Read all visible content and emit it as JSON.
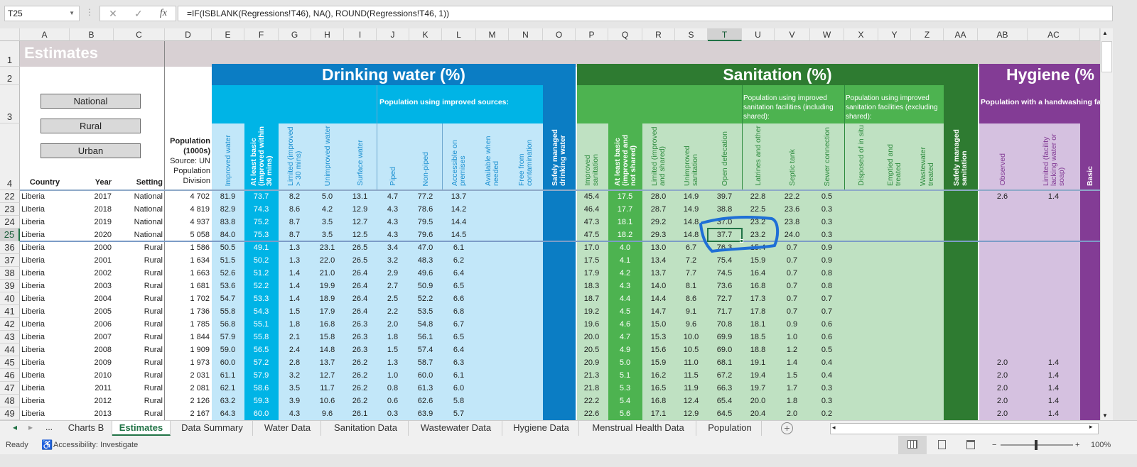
{
  "colors": {
    "light_blue": "#c2e7f9",
    "cyan": "#00b4e6",
    "dark_blue": "#0b7dc4",
    "light_green": "#bfe1c2",
    "mid_green": "#4db350",
    "dark_green": "#2e7b31",
    "light_purple": "#d5c1e0",
    "purple": "#833c95",
    "title_gray": "#d8d0d3",
    "selection": "#217346",
    "annotation": "#1f6fd6"
  },
  "formula_bar": {
    "name_box": "T25",
    "cancel_icon": "✕",
    "enter_icon": "✓",
    "fx_label": "fx",
    "formula": "=IF(ISBLANK(Regressions!T46), NA(), ROUND(Regressions!T46, 1))"
  },
  "columns": [
    "A",
    "B",
    "C",
    "D",
    "E",
    "F",
    "G",
    "H",
    "I",
    "J",
    "K",
    "L",
    "M",
    "N",
    "O",
    "P",
    "Q",
    "R",
    "S",
    "T",
    "U",
    "V",
    "W",
    "X",
    "Y",
    "Z",
    "AA",
    "AB",
    "AC"
  ],
  "header_rows": [
    "1",
    "2",
    "3",
    "4"
  ],
  "sheet_title": "Estimates",
  "setting_buttons": [
    "National",
    "Rural",
    "Urban"
  ],
  "titles": {
    "water": "Drinking water (%)",
    "sanitation": "Sanitation (%)",
    "hygiene": "Hygiene (%"
  },
  "groups": {
    "water_improved": "Population using improved sources:",
    "san_incl": "Population using improved sanitation facilities (including shared):",
    "san_excl": "Population using improved sanitation facilities (excluding shared):",
    "hygiene": "Population with a handwashing fa"
  },
  "column_headers": {
    "A": "Country",
    "B": "Year",
    "C": "Setting",
    "D_bold": "Population (1000s)",
    "D_source": "Source: UN Population Division",
    "E": "Improved water",
    "F": "At least basic (improved within 30 mins)",
    "G": "Limited (improved > 30 mins)",
    "H": "Unimproved water",
    "I": "Surface water",
    "J": "Piped",
    "K": "Non-piped",
    "L": "Accessible on premises",
    "M": "Available when needed",
    "N": "Free from contamination",
    "O": "Safely managed drinking water",
    "P": "Improved sanitation",
    "Q": "At least basic (improved and not shared)",
    "R": "Limited (improved and shared)",
    "S": "Unimproved sanitation",
    "T": "Open defecation",
    "U": "Latrines and other",
    "V": "Septic tank",
    "W": "Sewer connection",
    "X": "Disposed of in situ",
    "Y": "Emptied and treated",
    "Z": "Wastewater treated",
    "AA": "Safely managed sanitation",
    "AB": "Observed",
    "AC": "Limited (facility lacking water or soap)",
    "AD": "Basic"
  },
  "rows": [
    {
      "n": "22",
      "cells": [
        "Liberia",
        "2017",
        "National",
        "4 702",
        "81.9",
        "73.7",
        "8.2",
        "5.0",
        "13.1",
        "4.7",
        "77.2",
        "13.7",
        "",
        "",
        "",
        "45.4",
        "17.5",
        "28.0",
        "14.9",
        "39.7",
        "22.8",
        "22.2",
        "0.5",
        "",
        "",
        "",
        "",
        "2.6",
        "1.4"
      ]
    },
    {
      "n": "23",
      "cells": [
        "Liberia",
        "2018",
        "National",
        "4 819",
        "82.9",
        "74.3",
        "8.6",
        "4.2",
        "12.9",
        "4.3",
        "78.6",
        "14.2",
        "",
        "",
        "",
        "46.4",
        "17.7",
        "28.7",
        "14.9",
        "38.8",
        "22.5",
        "23.6",
        "0.3",
        "",
        "",
        "",
        "",
        "",
        ""
      ]
    },
    {
      "n": "24",
      "cells": [
        "Liberia",
        "2019",
        "National",
        "4 937",
        "83.8",
        "75.2",
        "8.7",
        "3.5",
        "12.7",
        "4.3",
        "79.5",
        "14.4",
        "",
        "",
        "",
        "47.3",
        "18.1",
        "29.2",
        "14.8",
        "37.0",
        "23.2",
        "23.8",
        "0.3",
        "",
        "",
        "",
        "",
        "",
        ""
      ]
    },
    {
      "n": "25",
      "cells": [
        "Liberia",
        "2020",
        "National",
        "5 058",
        "84.0",
        "75.3",
        "8.7",
        "3.5",
        "12.5",
        "4.3",
        "79.6",
        "14.5",
        "",
        "",
        "",
        "47.5",
        "18.2",
        "29.3",
        "14.8",
        "37.7",
        "23.2",
        "24.0",
        "0.3",
        "",
        "",
        "",
        "",
        "",
        ""
      ]
    },
    {
      "n": "36",
      "cells": [
        "Liberia",
        "2000",
        "Rural",
        "1 586",
        "50.5",
        "49.1",
        "1.3",
        "23.1",
        "26.5",
        "3.4",
        "47.0",
        "6.1",
        "",
        "",
        "",
        "17.0",
        "4.0",
        "13.0",
        "6.7",
        "76.3",
        "15.4",
        "0.7",
        "0.9",
        "",
        "",
        "",
        "",
        "",
        ""
      ]
    },
    {
      "n": "37",
      "cells": [
        "Liberia",
        "2001",
        "Rural",
        "1 634",
        "51.5",
        "50.2",
        "1.3",
        "22.0",
        "26.5",
        "3.2",
        "48.3",
        "6.2",
        "",
        "",
        "",
        "17.5",
        "4.1",
        "13.4",
        "7.2",
        "75.4",
        "15.9",
        "0.7",
        "0.9",
        "",
        "",
        "",
        "",
        "",
        ""
      ]
    },
    {
      "n": "38",
      "cells": [
        "Liberia",
        "2002",
        "Rural",
        "1 663",
        "52.6",
        "51.2",
        "1.4",
        "21.0",
        "26.4",
        "2.9",
        "49.6",
        "6.4",
        "",
        "",
        "",
        "17.9",
        "4.2",
        "13.7",
        "7.7",
        "74.5",
        "16.4",
        "0.7",
        "0.8",
        "",
        "",
        "",
        "",
        "",
        ""
      ]
    },
    {
      "n": "39",
      "cells": [
        "Liberia",
        "2003",
        "Rural",
        "1 681",
        "53.6",
        "52.2",
        "1.4",
        "19.9",
        "26.4",
        "2.7",
        "50.9",
        "6.5",
        "",
        "",
        "",
        "18.3",
        "4.3",
        "14.0",
        "8.1",
        "73.6",
        "16.8",
        "0.7",
        "0.8",
        "",
        "",
        "",
        "",
        "",
        ""
      ]
    },
    {
      "n": "40",
      "cells": [
        "Liberia",
        "2004",
        "Rural",
        "1 702",
        "54.7",
        "53.3",
        "1.4",
        "18.9",
        "26.4",
        "2.5",
        "52.2",
        "6.6",
        "",
        "",
        "",
        "18.7",
        "4.4",
        "14.4",
        "8.6",
        "72.7",
        "17.3",
        "0.7",
        "0.7",
        "",
        "",
        "",
        "",
        "",
        ""
      ]
    },
    {
      "n": "41",
      "cells": [
        "Liberia",
        "2005",
        "Rural",
        "1 736",
        "55.8",
        "54.3",
        "1.5",
        "17.9",
        "26.4",
        "2.2",
        "53.5",
        "6.8",
        "",
        "",
        "",
        "19.2",
        "4.5",
        "14.7",
        "9.1",
        "71.7",
        "17.8",
        "0.7",
        "0.7",
        "",
        "",
        "",
        "",
        "",
        ""
      ]
    },
    {
      "n": "42",
      "cells": [
        "Liberia",
        "2006",
        "Rural",
        "1 785",
        "56.8",
        "55.1",
        "1.8",
        "16.8",
        "26.3",
        "2.0",
        "54.8",
        "6.7",
        "",
        "",
        "",
        "19.6",
        "4.6",
        "15.0",
        "9.6",
        "70.8",
        "18.1",
        "0.9",
        "0.6",
        "",
        "",
        "",
        "",
        "",
        ""
      ]
    },
    {
      "n": "43",
      "cells": [
        "Liberia",
        "2007",
        "Rural",
        "1 844",
        "57.9",
        "55.8",
        "2.1",
        "15.8",
        "26.3",
        "1.8",
        "56.1",
        "6.5",
        "",
        "",
        "",
        "20.0",
        "4.7",
        "15.3",
        "10.0",
        "69.9",
        "18.5",
        "1.0",
        "0.6",
        "",
        "",
        "",
        "",
        "",
        ""
      ]
    },
    {
      "n": "44",
      "cells": [
        "Liberia",
        "2008",
        "Rural",
        "1 909",
        "59.0",
        "56.5",
        "2.4",
        "14.8",
        "26.3",
        "1.5",
        "57.4",
        "6.4",
        "",
        "",
        "",
        "20.5",
        "4.9",
        "15.6",
        "10.5",
        "69.0",
        "18.8",
        "1.2",
        "0.5",
        "",
        "",
        "",
        "",
        "",
        ""
      ]
    },
    {
      "n": "45",
      "cells": [
        "Liberia",
        "2009",
        "Rural",
        "1 973",
        "60.0",
        "57.2",
        "2.8",
        "13.7",
        "26.2",
        "1.3",
        "58.7",
        "6.3",
        "",
        "",
        "",
        "20.9",
        "5.0",
        "15.9",
        "11.0",
        "68.1",
        "19.1",
        "1.4",
        "0.4",
        "",
        "",
        "",
        "",
        "2.0",
        "1.4"
      ]
    },
    {
      "n": "46",
      "cells": [
        "Liberia",
        "2010",
        "Rural",
        "2 031",
        "61.1",
        "57.9",
        "3.2",
        "12.7",
        "26.2",
        "1.0",
        "60.0",
        "6.1",
        "",
        "",
        "",
        "21.3",
        "5.1",
        "16.2",
        "11.5",
        "67.2",
        "19.4",
        "1.5",
        "0.4",
        "",
        "",
        "",
        "",
        "2.0",
        "1.4"
      ]
    },
    {
      "n": "47",
      "cells": [
        "Liberia",
        "2011",
        "Rural",
        "2 081",
        "62.1",
        "58.6",
        "3.5",
        "11.7",
        "26.2",
        "0.8",
        "61.3",
        "6.0",
        "",
        "",
        "",
        "21.8",
        "5.3",
        "16.5",
        "11.9",
        "66.3",
        "19.7",
        "1.7",
        "0.3",
        "",
        "",
        "",
        "",
        "2.0",
        "1.4"
      ]
    },
    {
      "n": "48",
      "cells": [
        "Liberia",
        "2012",
        "Rural",
        "2 126",
        "63.2",
        "59.3",
        "3.9",
        "10.6",
        "26.2",
        "0.6",
        "62.6",
        "5.8",
        "",
        "",
        "",
        "22.2",
        "5.4",
        "16.8",
        "12.4",
        "65.4",
        "20.0",
        "1.8",
        "0.3",
        "",
        "",
        "",
        "",
        "2.0",
        "1.4"
      ]
    },
    {
      "n": "49",
      "cells": [
        "Liberia",
        "2013",
        "Rural",
        "2 167",
        "64.3",
        "60.0",
        "4.3",
        "9.6",
        "26.1",
        "0.3",
        "63.9",
        "5.7",
        "",
        "",
        "",
        "22.6",
        "5.6",
        "17.1",
        "12.9",
        "64.5",
        "20.4",
        "2.0",
        "0.2",
        "",
        "",
        "",
        "",
        "2.0",
        "1.4"
      ]
    }
  ],
  "tabs": {
    "prev": "◂",
    "next": "▸",
    "more": "...",
    "items": [
      "Charts B",
      "Estimates",
      "Data Summary",
      "Water Data",
      "Sanitation Data",
      "Wastewater Data",
      "Hygiene Data",
      "Menstrual Health Data",
      "Population"
    ],
    "active": "Estimates",
    "add": "+"
  },
  "status": {
    "ready": "Ready",
    "accessibility": "Accessibility: Investigate",
    "zoom": "100%",
    "zoom_minus": "−",
    "zoom_plus": "+",
    "zoom_level": 100
  }
}
